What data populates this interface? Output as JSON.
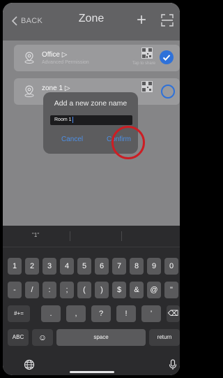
{
  "topbar": {
    "back": "BACK",
    "title": "Zone",
    "plus": "+"
  },
  "zones": [
    {
      "name": "Office",
      "subtitle": "Advanced Permission",
      "share_hint": "Tap to share",
      "selected": true
    },
    {
      "name": "zone 1",
      "subtitle": "",
      "share_hint": "",
      "selected": false
    }
  ],
  "dialog": {
    "title": "Add a new zone name",
    "input_value": "Room 1",
    "cancel": "Cancel",
    "confirm": "Confirm"
  },
  "keyboard": {
    "suggestion": "\"1\"",
    "row1": [
      "1",
      "2",
      "3",
      "4",
      "5",
      "6",
      "7",
      "8",
      "9",
      "0"
    ],
    "row2": [
      "-",
      "/",
      ":",
      ";",
      "(",
      ")",
      "$",
      "&",
      "@",
      "\""
    ],
    "row3": [
      "#+=",
      ".",
      ",",
      "?",
      "!",
      "'",
      "⌫"
    ],
    "row4": [
      "ABC",
      "☺",
      "space",
      "return"
    ]
  },
  "colors": {
    "accent": "#2e71d9",
    "highlight_circle": "#cc1e24"
  }
}
